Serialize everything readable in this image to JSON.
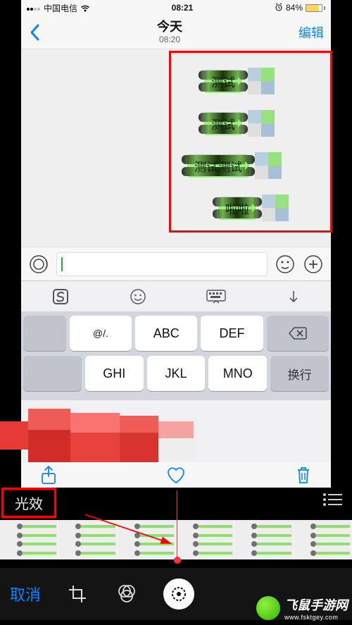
{
  "status": {
    "carrier": "中国电信",
    "time": "08:21",
    "battery_pct": "84%"
  },
  "nav": {
    "title": "今天",
    "subtitle": "08:20",
    "edit": "编辑"
  },
  "messages": [
    {
      "text": "测试"
    },
    {
      "text": "测试"
    },
    {
      "text": "测试测试"
    },
    {
      "text": "啦啦"
    }
  ],
  "keyboard": {
    "row1": [
      "@/.",
      "ABC",
      "DEF"
    ],
    "row2": [
      "GHI",
      "JKL",
      "MNO"
    ],
    "delete_label": "⌫",
    "enter_label": "换行",
    "left_blank": ""
  },
  "editor": {
    "effects_label": "光效",
    "cancel": "取消"
  },
  "watermark": {
    "text": "飞鼠手游网",
    "url": "www.fsktgey.com"
  }
}
